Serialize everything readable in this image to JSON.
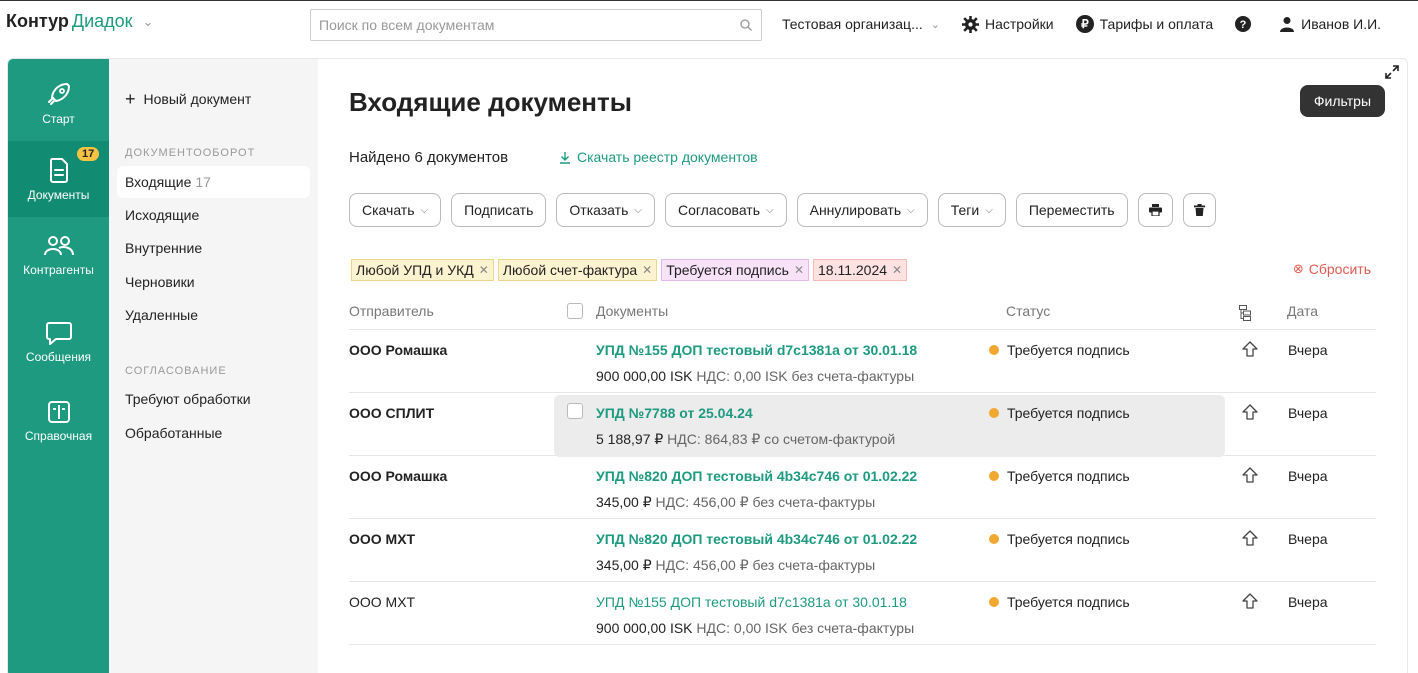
{
  "header": {
    "brand": "Контур",
    "brand_accent": "Диадок",
    "search_placeholder": "Поиск по всем документам",
    "org": "Тестовая организац...",
    "settings": "Настройки",
    "tariffs": "Тарифы и оплата",
    "user": "Иванов И.И."
  },
  "rail": {
    "items": [
      {
        "label": "Старт",
        "icon": "rocket-icon"
      },
      {
        "label": "Документы",
        "icon": "document-icon",
        "badge": "17"
      },
      {
        "label": "Контрагенты",
        "icon": "people-icon"
      },
      {
        "label": "Сообщения",
        "icon": "message-icon"
      },
      {
        "label": "Справочная",
        "icon": "book-icon"
      }
    ]
  },
  "subnav": {
    "new_doc": "Новый документ",
    "section_docflow": "ДОКУМЕНТООБОРОТ",
    "incoming": "Входящие",
    "incoming_count": "17",
    "outgoing": "Исходящие",
    "internal": "Внутренние",
    "drafts": "Черновики",
    "deleted": "Удаленные",
    "section_approval": "СОГЛАСОВАНИЕ",
    "need_processing": "Требуют обработки",
    "processed": "Обработанные"
  },
  "main": {
    "title": "Входящие документы",
    "filters_button": "Фильтры",
    "found": "Найдено 6 документов",
    "download_registry": "Скачать реестр документов",
    "toolbar": {
      "download": "Скачать",
      "sign": "Подписать",
      "reject": "Отказать",
      "approve": "Согласовать",
      "annul": "Аннулировать",
      "tags": "Теги",
      "move": "Переместить"
    },
    "chips": [
      {
        "label": "Любой УПД и УКД",
        "tone": "yellow"
      },
      {
        "label": "Любой счет-фактура",
        "tone": "yellow"
      },
      {
        "label": "Требуется подпись",
        "tone": "pink"
      },
      {
        "label": "18.11.2024",
        "tone": "red"
      }
    ],
    "reset": "Сбросить",
    "columns": {
      "sender": "Отправитель",
      "documents": "Документы",
      "status": "Статус",
      "date": "Дата"
    },
    "rows": [
      {
        "sender": "ООО Ромашка",
        "title": "УПД №155 ДОП тестовый d7c1381a от 30.01.18",
        "amount": "900 000,00 ISK",
        "sub": " НДС: 0,00 ISK без счета-фактуры",
        "status": "Требуется подпись",
        "date": "Вчера"
      },
      {
        "sender": "ООО СПЛИТ",
        "title": "УПД №7788 от 25.04.24",
        "amount": "5 188,97 ₽",
        "sub": " НДС: 864,83 ₽ со счетом-фактурой",
        "status": "Требуется подпись",
        "date": "Вчера"
      },
      {
        "sender": "ООО Ромашка",
        "title": "УПД №820 ДОП тестовый 4b34c746 от 01.02.22",
        "amount": "345,00 ₽",
        "sub": " НДС: 456,00 ₽ без счета-фактуры",
        "status": "Требуется подпись",
        "date": "Вчера"
      },
      {
        "sender": "ООО МХТ",
        "title": "УПД №820 ДОП тестовый 4b34c746 от 01.02.22",
        "amount": "345,00 ₽",
        "sub": " НДС: 456,00 ₽ без счета-фактуры",
        "status": "Требуется подпись",
        "date": "Вчера"
      },
      {
        "sender": "ООО МХТ",
        "title": "УПД №155 ДОП тестовый d7c1381a от 30.01.18",
        "amount": "900 000,00 ISK",
        "sub": " НДС: 0,00 ISK без счета-фактуры",
        "status": "Требуется подпись",
        "date": "Вчера"
      }
    ]
  },
  "colors": {
    "accent": "#1d9a80",
    "status_warning": "#f0a830",
    "reset": "#e05a4f"
  }
}
